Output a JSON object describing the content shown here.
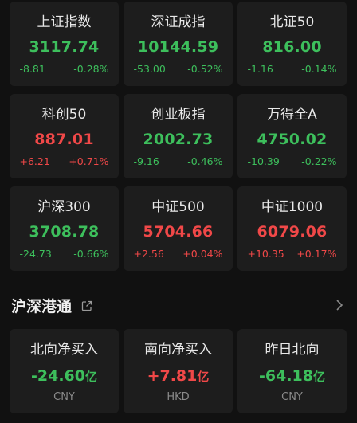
{
  "indices": [
    {
      "name": "上证指数",
      "value": "3117.74",
      "change": "-8.81",
      "pct": "-0.28%",
      "dir": "down"
    },
    {
      "name": "深证成指",
      "value": "10144.59",
      "change": "-53.00",
      "pct": "-0.52%",
      "dir": "down"
    },
    {
      "name": "北证50",
      "value": "816.00",
      "change": "-1.16",
      "pct": "-0.14%",
      "dir": "down"
    },
    {
      "name": "科创50",
      "value": "887.01",
      "change": "+6.21",
      "pct": "+0.71%",
      "dir": "up"
    },
    {
      "name": "创业板指",
      "value": "2002.73",
      "change": "-9.16",
      "pct": "-0.46%",
      "dir": "down"
    },
    {
      "name": "万得全A",
      "value": "4750.02",
      "change": "-10.39",
      "pct": "-0.22%",
      "dir": "down"
    },
    {
      "name": "沪深300",
      "value": "3708.78",
      "change": "-24.73",
      "pct": "-0.66%",
      "dir": "down"
    },
    {
      "name": "中证500",
      "value": "5704.66",
      "change": "+2.56",
      "pct": "+0.04%",
      "dir": "up"
    },
    {
      "name": "中证1000",
      "value": "6079.06",
      "change": "+10.35",
      "pct": "+0.17%",
      "dir": "up"
    }
  ],
  "section": {
    "title": "沪深港通",
    "link_icon": "external-link-icon",
    "more_icon": "chevron-right-icon"
  },
  "flows": [
    {
      "name": "北向净买入",
      "value": "-24.60",
      "unit": "亿",
      "currency": "CNY",
      "dir": "down"
    },
    {
      "name": "南向净买入",
      "value": "+7.81",
      "unit": "亿",
      "currency": "HKD",
      "dir": "up"
    },
    {
      "name": "昨日北向",
      "value": "-64.18",
      "unit": "亿",
      "currency": "CNY",
      "dir": "down"
    }
  ],
  "colors": {
    "up": "#f04848",
    "down": "#3dbf5c",
    "card": "#1d1d1d",
    "background": "#111111"
  }
}
